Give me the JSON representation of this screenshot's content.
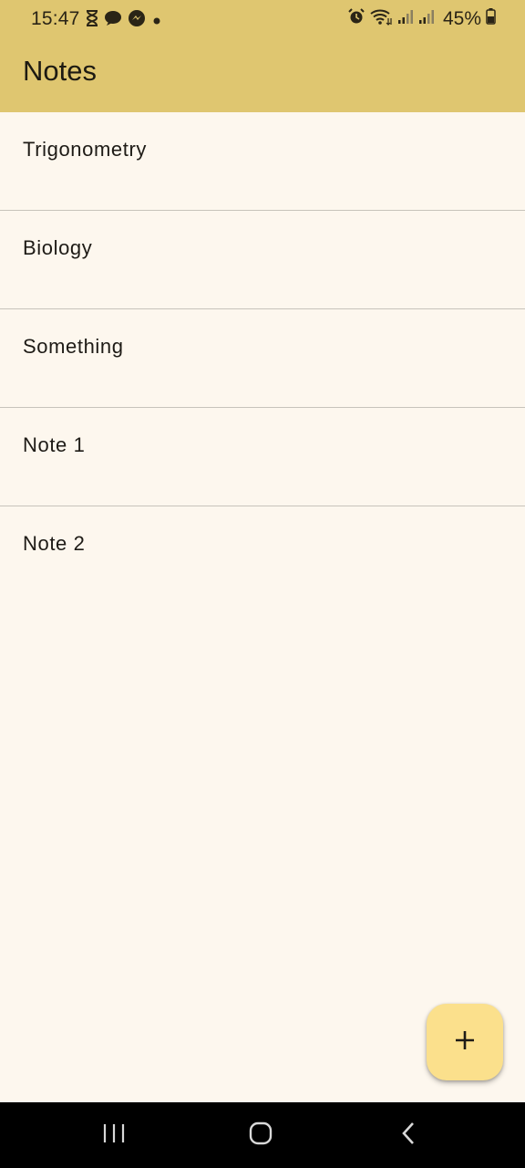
{
  "status_bar": {
    "time": "15:47",
    "battery": "45%",
    "left_icons": [
      "hourglass-icon",
      "chat-bubble-icon",
      "messenger-icon",
      "dot-icon"
    ],
    "right_icons": [
      "alarm-icon",
      "wifi-icon",
      "signal-icon",
      "signal-icon",
      "battery-icon"
    ]
  },
  "appbar": {
    "title": "Notes",
    "color": "#dfc670"
  },
  "notes": [
    {
      "title": "Trigonometry"
    },
    {
      "title": "Biology"
    },
    {
      "title": "Something"
    },
    {
      "title": "Note 1"
    },
    {
      "title": "Note 2"
    }
  ],
  "fab": {
    "icon": "plus-icon",
    "color": "#fbe08c"
  },
  "nav_bar": {
    "buttons": [
      "recents-icon",
      "home-icon",
      "back-icon"
    ]
  },
  "colors": {
    "background": "#fdf7ee",
    "divider": "#c7c3bb"
  }
}
